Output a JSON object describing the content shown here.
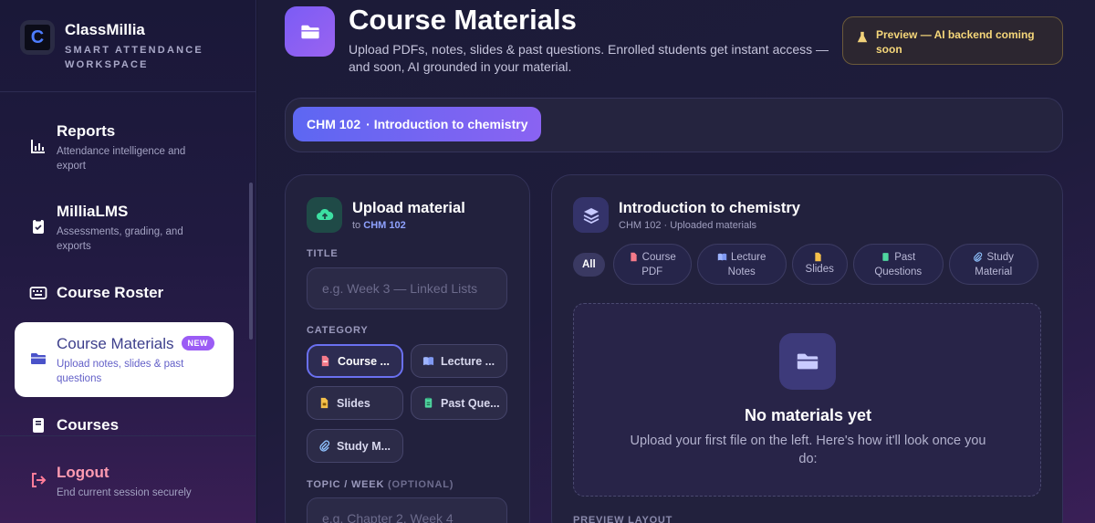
{
  "brand": {
    "name": "ClassMillia",
    "subtitle": "SMART ATTENDANCE WORKSPACE",
    "logo_letter": "C"
  },
  "sidebar": {
    "items": [
      {
        "label": "Reports",
        "desc": "Attendance intelligence and export",
        "icon": "bar-chart-icon"
      },
      {
        "label": "MilliaLMS",
        "desc": "Assessments, grading, and exports",
        "icon": "clipboard-icon"
      },
      {
        "label": "Course Roster",
        "desc": "",
        "icon": "keyboard-icon"
      },
      {
        "label": "Course Materials",
        "badge": "NEW",
        "desc": "Upload notes, slides & past questions",
        "icon": "folder-icon",
        "active": true
      },
      {
        "label": "Courses",
        "desc": "",
        "icon": "book-icon"
      }
    ],
    "logout": {
      "label": "Logout",
      "desc": "End current session securely",
      "icon": "logout-icon"
    }
  },
  "header": {
    "title": "Course Materials",
    "subtitle": "Upload PDFs, notes, slides & past questions. Enrolled students get instant access — and soon, AI grounded in your material.",
    "preview_pill": "Preview — AI backend coming soon"
  },
  "course_selector": {
    "code": "CHM 102",
    "name": "· Introduction to chemistry"
  },
  "upload": {
    "title": "Upload material",
    "to_prefix": "to",
    "course_code": "CHM 102",
    "title_label": "TITLE",
    "title_placeholder": "e.g. Week 3 — Linked Lists",
    "category_label": "CATEGORY",
    "categories": [
      {
        "label": "Course PDF",
        "display": "Course ...",
        "icon": "pdf-icon",
        "selected": true
      },
      {
        "label": "Lecture Notes",
        "display": "Lecture ...",
        "icon": "open-book-icon"
      },
      {
        "label": "Slides",
        "display": "Slides",
        "icon": "slides-icon"
      },
      {
        "label": "Past Questions",
        "display": "Past Que...",
        "icon": "question-doc-icon"
      },
      {
        "label": "Study Material",
        "display": "Study M...",
        "icon": "paperclip-icon"
      }
    ],
    "topic_label": "TOPIC / WEEK",
    "topic_optional": "(OPTIONAL)",
    "topic_placeholder": "e.g. Chapter 2, Week 4"
  },
  "materials": {
    "title": "Introduction to chemistry",
    "subtitle": "CHM 102 · Uploaded materials",
    "filter_all": "All",
    "filters": [
      {
        "line1": "Course",
        "line2": "PDF",
        "icon": "pdf-icon"
      },
      {
        "line1": "Lecture",
        "line2": "Notes",
        "icon": "open-book-icon"
      },
      {
        "line1": "",
        "line2": "Slides",
        "icon": "slides-icon"
      },
      {
        "line1": "Past",
        "line2": "Questions",
        "icon": "question-doc-icon"
      },
      {
        "line1": "Study",
        "line2": "Material",
        "icon": "paperclip-icon"
      }
    ],
    "empty_title": "No materials yet",
    "empty_text": "Upload your first file on the left. Here's how it'll look once you do:",
    "preview_layout_label": "PREVIEW LAYOUT"
  },
  "colors": {
    "accent": "#6a70f0",
    "accent_violet": "#9b5cf5",
    "preview_text": "#f6d77a",
    "logout": "#ff9bb1"
  }
}
